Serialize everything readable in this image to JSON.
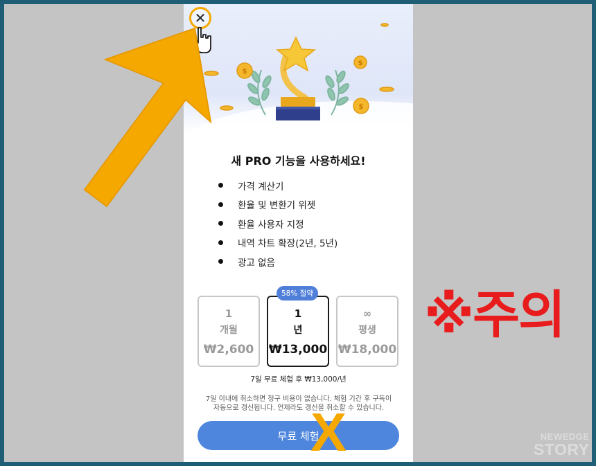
{
  "dialog": {
    "close_glyph": "✕",
    "title": "새 PRO 기능을 사용하세요!",
    "features": [
      "가격 계산기",
      "환율 및 변환기 위젯",
      "환율 사용자 지정",
      "내역 차트 확장(2년, 5년)",
      "광고 없음"
    ],
    "plans": [
      {
        "num": "1",
        "unit": "개월",
        "price": "₩2,600"
      },
      {
        "num": "1",
        "unit": "년",
        "price": "₩13,000"
      },
      {
        "num": "∞",
        "unit": "평생",
        "price": "₩18,000"
      }
    ],
    "selected_plan": "1년",
    "badge": "58% 절약",
    "trial_note": "7일 무료 체험 후 ₩13,000/년",
    "cancel_note_line1": "7일 이내에 취소하면 청구 비용이 없습니다. 체험 기간 후 구독이",
    "cancel_note_line2": "자동으로 갱신됩니다. 언제라도 갱신을 취소할 수 있습니다.",
    "cta": "무료 체험"
  },
  "annotations": {
    "x_mark": "X",
    "warning": "※주의",
    "arrow_color": "#f5a800",
    "warning_color": "#e81c1c"
  },
  "watermark": {
    "line1": "NEWEDGE",
    "line2": "STORY"
  },
  "colors": {
    "frame": "#1f5e74",
    "background": "#c4c4c4",
    "accent_blue": "#4f86dd",
    "badge_blue": "#4f7fd8"
  }
}
